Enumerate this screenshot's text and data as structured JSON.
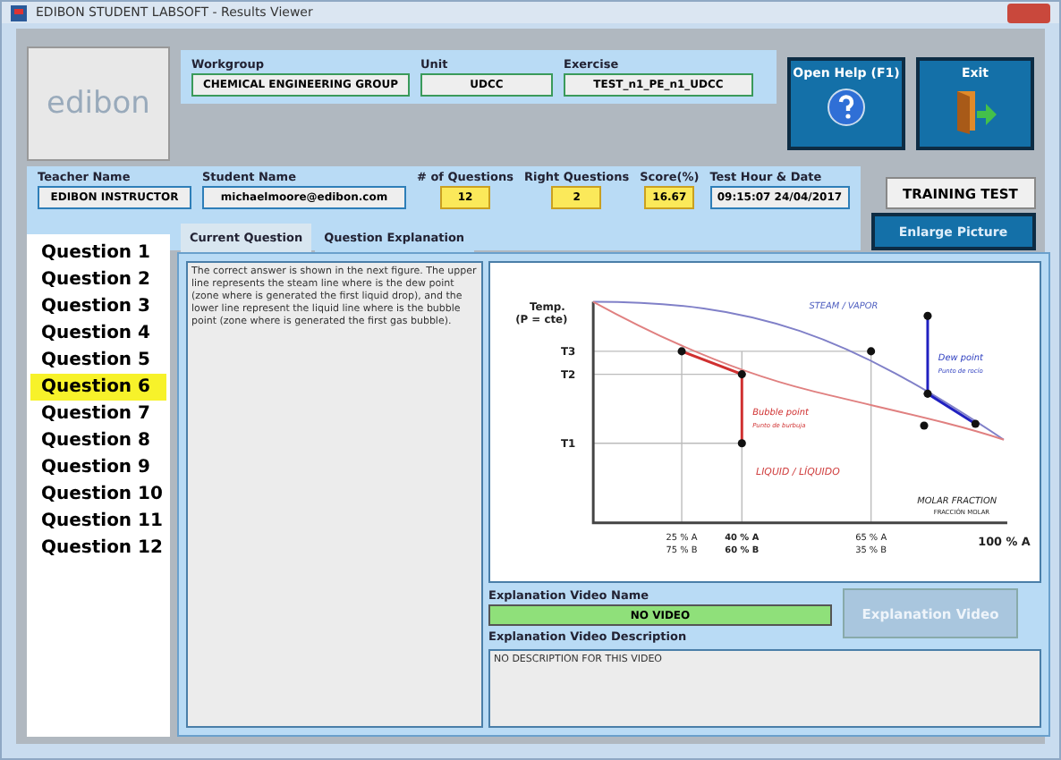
{
  "window": {
    "title": "EDIBON STUDENT LABSOFT - Results Viewer"
  },
  "logo": {
    "text": "edibon"
  },
  "info": [
    {
      "label": "Workgroup",
      "value": "CHEMICAL ENGINEERING GROUP"
    },
    {
      "label": "Unit",
      "value": "UDCC"
    },
    {
      "label": "Exercise",
      "value": "TEST_n1_PE_n1_UDCC"
    }
  ],
  "help_button": {
    "label": "Open Help (F1)"
  },
  "exit_button": {
    "label": "Exit"
  },
  "details": [
    {
      "label": "Teacher Name",
      "value": "EDIBON INSTRUCTOR",
      "kind": "name"
    },
    {
      "label": "Student Name",
      "value": "michaelmoore@edibon.com",
      "kind": "name"
    },
    {
      "label": "# of Questions",
      "value": "12",
      "kind": "count"
    },
    {
      "label": "Right Questions",
      "value": "2",
      "kind": "count"
    },
    {
      "label": "Score(%)",
      "value": "16.67",
      "kind": "count"
    },
    {
      "label": "Test Hour & Date",
      "value": "09:15:07 24/04/2017",
      "kind": "date"
    }
  ],
  "test_type": "TRAINING TEST",
  "enlarge_button": "Enlarge Picture",
  "questions": [
    {
      "label": "Question 1",
      "selected": false
    },
    {
      "label": "Question 2",
      "selected": false
    },
    {
      "label": "Question 3",
      "selected": false
    },
    {
      "label": "Question 4",
      "selected": false
    },
    {
      "label": "Question 5",
      "selected": false
    },
    {
      "label": "Question 6",
      "selected": true
    },
    {
      "label": "Question 7",
      "selected": false
    },
    {
      "label": "Question 8",
      "selected": false
    },
    {
      "label": "Question 9",
      "selected": false
    },
    {
      "label": "Question 10",
      "selected": false
    },
    {
      "label": "Question 11",
      "selected": false
    },
    {
      "label": "Question 12",
      "selected": false
    }
  ],
  "tabs": [
    {
      "label": "Current Question",
      "selected": false
    },
    {
      "label": "Question Explanation",
      "selected": true
    }
  ],
  "explanation": "The correct answer is shown in the next figure. The upper line represents the steam line where is the dew point (zone where is generated the first liquid drop), and the lower line represent the liquid line where is the bubble point (zone where is generated the first gas bubble).",
  "figure": {
    "y_label": [
      "Temp.",
      "(P = cte)"
    ],
    "levels": [
      "T3",
      "T2",
      "T1"
    ],
    "vapor": "STEAM / VAPOR",
    "liquid": "LIQUID / LÍQUIDO",
    "dew": [
      "Dew point",
      "Punto de rocío"
    ],
    "bubble": [
      "Bubble point",
      "Punto de burbuja"
    ],
    "x_title": [
      "MOLAR FRACTION",
      "FRACCIÓN MOLAR"
    ],
    "x_ticks": [
      [
        "25 % A",
        "75 % B"
      ],
      [
        "40 % A",
        "60 % B"
      ],
      [
        "65 % A",
        "35 % B"
      ]
    ],
    "x_end": "100 % A"
  },
  "video": {
    "name_label": "Explanation Video Name",
    "name": "NO VIDEO",
    "button": "Explanation Video",
    "description_label": "Explanation Video Description",
    "description": "NO DESCRIPTION FOR THIS VIDEO"
  }
}
